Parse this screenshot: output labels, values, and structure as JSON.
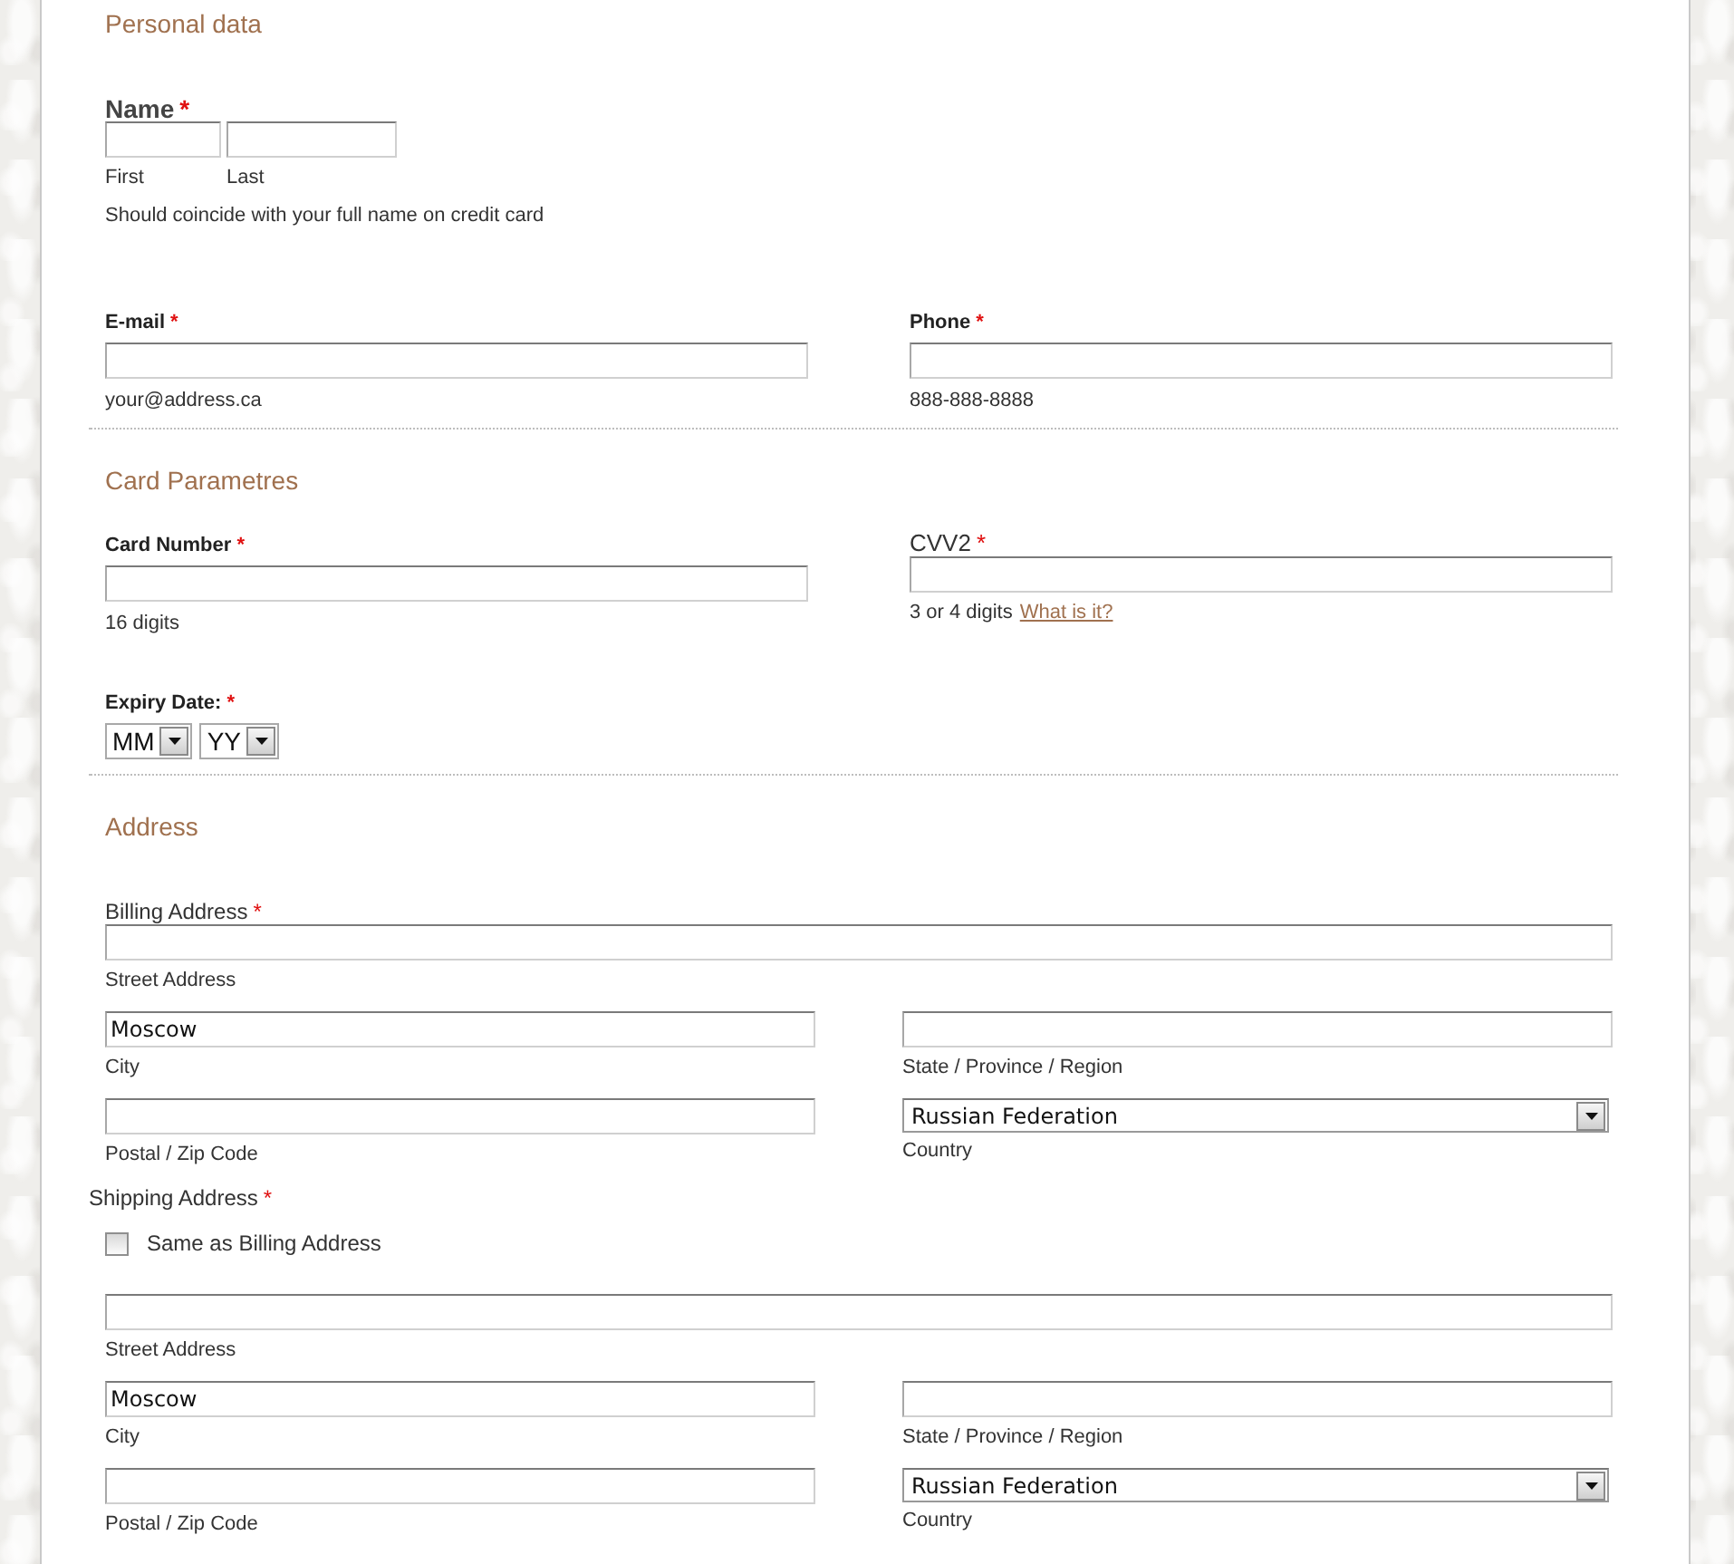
{
  "sections": [
    {
      "title": "Personal data",
      "blocks": [
        {
          "kind": "name",
          "label": "Name",
          "mark": "*",
          "fields": [
            {
              "sublabel": "First"
            },
            {
              "sublabel": "Last"
            }
          ],
          "note": "Should coincide with your full name on credit card"
        },
        {
          "kind": "pair",
          "items": [
            {
              "kind": "standard",
              "label": "E-mail",
              "mark": "*",
              "hint": "your@address.ca"
            },
            {
              "kind": "standard",
              "label": "Phone",
              "mark": "*",
              "hint": "888-888-8888"
            }
          ]
        }
      ]
    },
    {
      "title": "Card Parametres",
      "blocks": [
        {
          "kind": "pair",
          "items": [
            {
              "kind": "standard",
              "label": "Card Number",
              "mark": "*",
              "hint": "16 digits"
            },
            {
              "kind": "large",
              "label": "CVV2",
              "mark": "*",
              "hint": "3 or 4 digits",
              "link": "What is it?"
            }
          ]
        },
        {
          "kind": "expiry",
          "label": "Expiry Date:",
          "mark": "*",
          "selects": [
            {
              "value": "MM"
            },
            {
              "value": "YY"
            }
          ]
        }
      ]
    },
    {
      "title": "Address",
      "blocks": [
        {
          "kind": "address",
          "label": "Billing Address",
          "mark": "*",
          "street": {
            "sublabel": "Street Address"
          },
          "city": {
            "value": "Moscow",
            "sublabel": "City"
          },
          "state": {
            "sublabel": "State / Province / Region"
          },
          "postal": {
            "sublabel": "Postal / Zip Code"
          },
          "country": {
            "value": "Russian Federation",
            "sublabel": "Country"
          }
        },
        {
          "kind": "address",
          "label": "Shipping Address",
          "mark": "*",
          "same_as": {
            "label": "Same as Billing Address",
            "checked": false
          },
          "street": {
            "sublabel": "Street Address"
          },
          "city": {
            "value": "Moscow",
            "sublabel": "City"
          },
          "state": {
            "sublabel": "State / Province / Region"
          },
          "postal": {
            "sublabel": "Postal / Zip Code"
          },
          "country": {
            "value": "Russian Federation",
            "sublabel": "Country"
          }
        }
      ]
    }
  ]
}
